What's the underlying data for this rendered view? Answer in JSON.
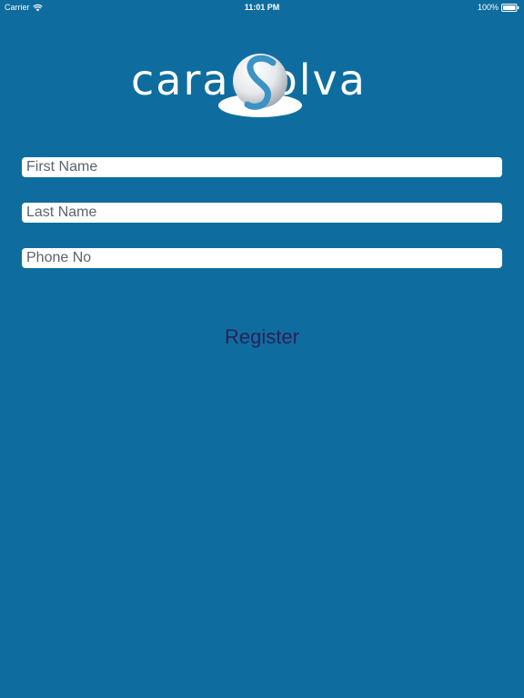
{
  "status_bar": {
    "carrier": "Carrier",
    "time": "11:01 PM",
    "battery": "100%"
  },
  "logo": {
    "text_left": "cara",
    "text_right": "olva"
  },
  "form": {
    "first_name_placeholder": "First Name",
    "last_name_placeholder": "Last Name",
    "phone_placeholder": "Phone No"
  },
  "register_label": "Register",
  "colors": {
    "background": "#0e6d9e",
    "register_text": "#2c2159",
    "field_background": "#ffffff"
  },
  "icons": [
    "wifi-icon",
    "battery-icon",
    "logo-ball-icon"
  ]
}
